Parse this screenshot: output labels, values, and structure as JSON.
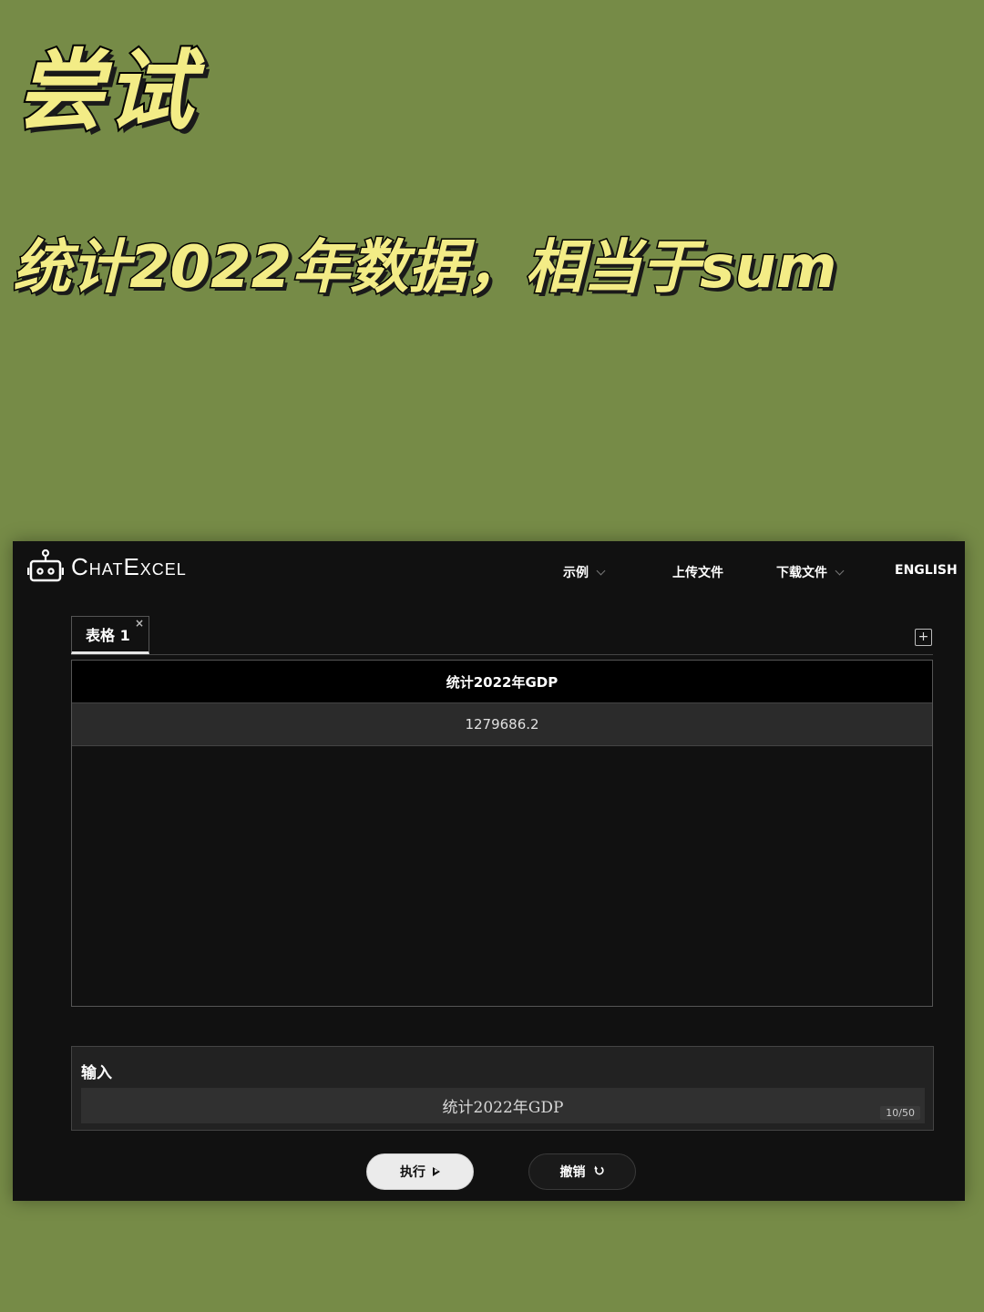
{
  "overlay": {
    "headline": "尝试",
    "subhead": "统计2022年数据，相当于sum"
  },
  "app": {
    "logo": {
      "text": "ChatExcel",
      "icon": "robot-icon"
    },
    "nav": [
      {
        "label": "示例",
        "has_dropdown": true
      },
      {
        "label": "上传文件",
        "has_dropdown": false
      },
      {
        "label": "下载文件",
        "has_dropdown": true
      },
      {
        "label": "ENGLISH",
        "has_dropdown": false
      }
    ],
    "sheet_tab": {
      "label": "表格 1",
      "close": "×"
    },
    "add_sheet": "+",
    "table": {
      "header": "统计2022年GDP",
      "rows": [
        "1279686.2"
      ]
    },
    "input": {
      "label": "输入",
      "value": "统计2022年GDP",
      "counter": "10/50"
    },
    "buttons": {
      "run": "执行",
      "undo": "撤销"
    }
  },
  "colors": {
    "background": "#768b47",
    "overlay_text": "#f3ec86",
    "app_bg": "#111111"
  }
}
